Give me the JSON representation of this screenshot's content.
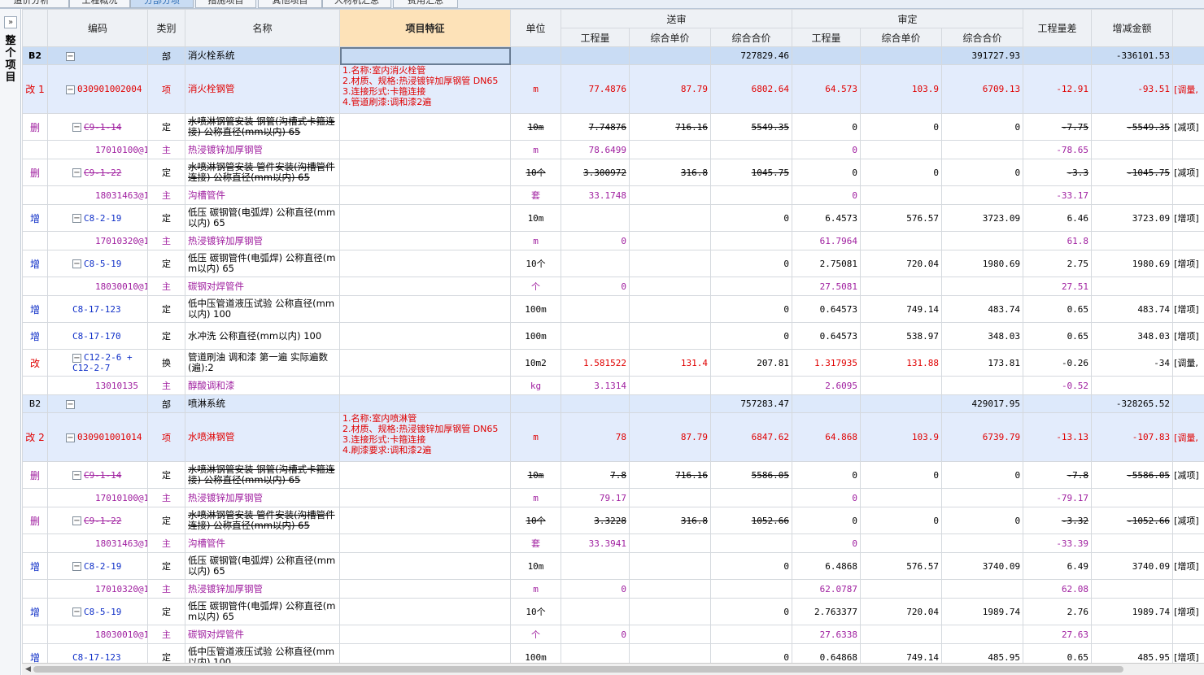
{
  "tabs": [
    {
      "label": "造价分析",
      "active": false
    },
    {
      "label": "工程概况",
      "active": false
    },
    {
      "label": "分部分项",
      "active": true
    },
    {
      "label": "措施项目",
      "active": false
    },
    {
      "label": "其他项目",
      "active": false
    },
    {
      "label": "人材机汇总",
      "active": false
    },
    {
      "label": "费用汇总",
      "active": false
    }
  ],
  "sidebar": {
    "expand_icon": "double-chevron-right-icon",
    "expand_glyph": "»",
    "label": "整个项目"
  },
  "header": {
    "bianma": "编码",
    "leibie": "类别",
    "mingcheng": "名称",
    "xiangmu_tezheng": "项目特征",
    "danwei": "单位",
    "songshen": "送审",
    "shending": "审定",
    "gongchengliang": "工程量",
    "zonghe_danjia": "综合单价",
    "zonghe_hejia": "综合合价",
    "gongchengliang_cha": "工程量差",
    "zengjian_jine": "增减金额"
  },
  "rows": [
    {
      "type": "bu",
      "mark": "B2",
      "code": "",
      "lb": "部",
      "name": "消火栓系统",
      "feat": "",
      "unit": "",
      "sq": "",
      "sp": "",
      "st": "727829.46",
      "dq": "",
      "dp": "",
      "dt": "391727.93",
      "diff": "",
      "amt": "-336101.53",
      "note": ""
    },
    {
      "type": "xiang",
      "mark": "改 1",
      "code": "030901002004",
      "lb": "项",
      "name": "消火栓钢管",
      "feat": "1.名称:室内消火栓管\n2.材质、规格:热浸镀锌加厚钢管 DN65\n3.连接形式:卡箍连接\n4.管道刷漆:调和漆2遍",
      "unit": "m",
      "sq": "77.4876",
      "sp": "87.79",
      "st": "6802.64",
      "dq": "64.573",
      "dp": "103.9",
      "dt": "6709.13",
      "diff": "-12.91",
      "amt": "-93.51",
      "note": "[调量,"
    },
    {
      "type": "ding",
      "status": "del",
      "mark": "删",
      "code": "C9-1-14",
      "lb": "定",
      "name": "水喷淋钢管安装 钢管(沟槽式卡箍连接) 公称直径(mm以内) 65",
      "unit": "10m",
      "sq": "7.74876",
      "sp": "716.16",
      "st": "5549.35",
      "dq": "0",
      "dp": "0",
      "dt": "0",
      "diff": "-7.75",
      "amt": "-5549.35",
      "note": "[减项]"
    },
    {
      "type": "zhu",
      "status": "del",
      "mark": "",
      "code": "17010100@1",
      "lb": "主",
      "name": "热浸镀锌加厚钢管",
      "unit": "m",
      "sq": "78.6499",
      "sp": "",
      "st": "",
      "dq": "0",
      "dp": "",
      "dt": "",
      "diff": "-78.65",
      "amt": "",
      "note": ""
    },
    {
      "type": "ding",
      "status": "del",
      "mark": "删",
      "code": "C9-1-22",
      "lb": "定",
      "name": "水喷淋钢管安装 管件安装(沟槽管件连接) 公称直径(mm以内) 65",
      "unit": "10个",
      "sq": "3.300972",
      "sp": "316.8",
      "st": "1045.75",
      "dq": "0",
      "dp": "0",
      "dt": "0",
      "diff": "-3.3",
      "amt": "-1045.75",
      "note": "[减项]"
    },
    {
      "type": "zhu",
      "status": "del",
      "mark": "",
      "code": "18031463@1",
      "lb": "主",
      "name": "沟槽管件",
      "unit": "套",
      "sq": "33.1748",
      "sp": "",
      "st": "",
      "dq": "0",
      "dp": "",
      "dt": "",
      "diff": "-33.17",
      "amt": "",
      "note": ""
    },
    {
      "type": "ding",
      "status": "add",
      "mark": "增",
      "code": "C8-2-19",
      "lb": "定",
      "name": "低压 碳钢管(电弧焊) 公称直径(mm以内) 65",
      "unit": "10m",
      "sq": "",
      "sp": "",
      "st": "0",
      "dq": "6.4573",
      "dp": "576.57",
      "dt": "3723.09",
      "diff": "6.46",
      "amt": "3723.09",
      "note": "[增项]"
    },
    {
      "type": "zhu",
      "status": "add",
      "mark": "",
      "code": "17010320@1",
      "lb": "主",
      "name": "热浸镀锌加厚钢管",
      "unit": "m",
      "sq": "0",
      "sp": "",
      "st": "",
      "dq": "61.7964",
      "dp": "",
      "dt": "",
      "diff": "61.8",
      "amt": "",
      "note": ""
    },
    {
      "type": "ding",
      "status": "add",
      "mark": "增",
      "code": "C8-5-19",
      "lb": "定",
      "name": "低压 碳钢管件(电弧焊) 公称直径(mm以内) 65",
      "unit": "10个",
      "sq": "",
      "sp": "",
      "st": "0",
      "dq": "2.75081",
      "dp": "720.04",
      "dt": "1980.69",
      "diff": "2.75",
      "amt": "1980.69",
      "note": "[增项]"
    },
    {
      "type": "zhu",
      "status": "add",
      "mark": "",
      "code": "18030010@1",
      "lb": "主",
      "name": "碳钢对焊管件",
      "unit": "个",
      "sq": "0",
      "sp": "",
      "st": "",
      "dq": "27.5081",
      "dp": "",
      "dt": "",
      "diff": "27.51",
      "amt": "",
      "note": ""
    },
    {
      "type": "ding",
      "status": "add",
      "mark": "增",
      "code": "C8-17-123",
      "lb": "定",
      "name": "低中压管道液压试验 公称直径(mm以内) 100",
      "unit": "100m",
      "sq": "",
      "sp": "",
      "st": "0",
      "dq": "0.64573",
      "dp": "749.14",
      "dt": "483.74",
      "diff": "0.65",
      "amt": "483.74",
      "note": "[增项]"
    },
    {
      "type": "ding",
      "status": "add",
      "mark": "增",
      "code": "C8-17-170",
      "lb": "定",
      "name": "水冲洗 公称直径(mm以内) 100",
      "unit": "100m",
      "sq": "",
      "sp": "",
      "st": "0",
      "dq": "0.64573",
      "dp": "538.97",
      "dt": "348.03",
      "diff": "0.65",
      "amt": "348.03",
      "note": "[增项]"
    },
    {
      "type": "ding",
      "status": "chg",
      "mark": "改",
      "code": "C12-2-6 + C12-2-7",
      "lb": "换",
      "name": "管道刷油 调和漆 第一遍  实际遍数(遍):2",
      "unit": "10m2",
      "sq": "1.581522",
      "sp": "131.4",
      "st": "207.81",
      "dq": "1.317935",
      "dp": "131.88",
      "dt": "173.81",
      "diff": "-0.26",
      "amt": "-34",
      "note": "[调量,"
    },
    {
      "type": "zhu",
      "status": "chg",
      "mark": "",
      "code": "13010135",
      "lb": "主",
      "name": "醇酸调和漆",
      "unit": "kg",
      "sq": "3.1314",
      "sp": "",
      "st": "",
      "dq": "2.6095",
      "dp": "",
      "dt": "",
      "diff": "-0.52",
      "amt": "",
      "note": ""
    },
    {
      "type": "bu",
      "mark": "B2",
      "code": "",
      "lb": "部",
      "name": "喷淋系统",
      "feat": "",
      "unit": "",
      "sq": "",
      "sp": "",
      "st": "757283.47",
      "dq": "",
      "dp": "",
      "dt": "429017.95",
      "diff": "",
      "amt": "-328265.52",
      "note": ""
    },
    {
      "type": "xiang",
      "mark": "改 2",
      "code": "030901001014",
      "lb": "项",
      "name": "水喷淋钢管",
      "feat": "1.名称:室内喷淋管\n2.材质、规格:热浸镀锌加厚钢管 DN65\n3.连接形式:卡箍连接\n4.刷漆要求:调和漆2遍",
      "unit": "m",
      "sq": "78",
      "sp": "87.79",
      "st": "6847.62",
      "dq": "64.868",
      "dp": "103.9",
      "dt": "6739.79",
      "diff": "-13.13",
      "amt": "-107.83",
      "note": "[调量,"
    },
    {
      "type": "ding",
      "status": "del",
      "mark": "删",
      "code": "C9-1-14",
      "lb": "定",
      "name": "水喷淋钢管安装 钢管(沟槽式卡箍连接) 公称直径(mm以内) 65",
      "unit": "10m",
      "sq": "7.8",
      "sp": "716.16",
      "st": "5586.05",
      "dq": "0",
      "dp": "0",
      "dt": "0",
      "diff": "-7.8",
      "amt": "-5586.05",
      "note": "[减项]"
    },
    {
      "type": "zhu",
      "status": "del",
      "mark": "",
      "code": "17010100@1",
      "lb": "主",
      "name": "热浸镀锌加厚钢管",
      "unit": "m",
      "sq": "79.17",
      "sp": "",
      "st": "",
      "dq": "0",
      "dp": "",
      "dt": "",
      "diff": "-79.17",
      "amt": "",
      "note": ""
    },
    {
      "type": "ding",
      "status": "del",
      "mark": "删",
      "code": "C9-1-22",
      "lb": "定",
      "name": "水喷淋钢管安装 管件安装(沟槽管件连接) 公称直径(mm以内) 65",
      "unit": "10个",
      "sq": "3.3228",
      "sp": "316.8",
      "st": "1052.66",
      "dq": "0",
      "dp": "0",
      "dt": "0",
      "diff": "-3.32",
      "amt": "-1052.66",
      "note": "[减项]"
    },
    {
      "type": "zhu",
      "status": "del",
      "mark": "",
      "code": "18031463@1",
      "lb": "主",
      "name": "沟槽管件",
      "unit": "套",
      "sq": "33.3941",
      "sp": "",
      "st": "",
      "dq": "0",
      "dp": "",
      "dt": "",
      "diff": "-33.39",
      "amt": "",
      "note": ""
    },
    {
      "type": "ding",
      "status": "add",
      "mark": "增",
      "code": "C8-2-19",
      "lb": "定",
      "name": "低压 碳钢管(电弧焊) 公称直径(mm以内) 65",
      "unit": "10m",
      "sq": "",
      "sp": "",
      "st": "0",
      "dq": "6.4868",
      "dp": "576.57",
      "dt": "3740.09",
      "diff": "6.49",
      "amt": "3740.09",
      "note": "[增项]"
    },
    {
      "type": "zhu",
      "status": "add",
      "mark": "",
      "code": "17010320@1",
      "lb": "主",
      "name": "热浸镀锌加厚钢管",
      "unit": "m",
      "sq": "0",
      "sp": "",
      "st": "",
      "dq": "62.0787",
      "dp": "",
      "dt": "",
      "diff": "62.08",
      "amt": "",
      "note": ""
    },
    {
      "type": "ding",
      "status": "add",
      "mark": "增",
      "code": "C8-5-19",
      "lb": "定",
      "name": "低压 碳钢管件(电弧焊) 公称直径(mm以内) 65",
      "unit": "10个",
      "sq": "",
      "sp": "",
      "st": "0",
      "dq": "2.763377",
      "dp": "720.04",
      "dt": "1989.74",
      "diff": "2.76",
      "amt": "1989.74",
      "note": "[增项]"
    },
    {
      "type": "zhu",
      "status": "add",
      "mark": "",
      "code": "18030010@1",
      "lb": "主",
      "name": "碳钢对焊管件",
      "unit": "个",
      "sq": "0",
      "sp": "",
      "st": "",
      "dq": "27.6338",
      "dp": "",
      "dt": "",
      "diff": "27.63",
      "amt": "",
      "note": ""
    },
    {
      "type": "ding",
      "status": "add",
      "mark": "增",
      "code": "C8-17-123",
      "lb": "定",
      "name": "低中压管道液压试验 公称直径(mm以内) 100",
      "unit": "100m",
      "sq": "",
      "sp": "",
      "st": "0",
      "dq": "0.64868",
      "dp": "749.14",
      "dt": "485.95",
      "diff": "0.65",
      "amt": "485.95",
      "note": "[增项]"
    }
  ],
  "scrollbar": {
    "left_icon": "scroll-left-icon",
    "left_glyph": "◀"
  }
}
